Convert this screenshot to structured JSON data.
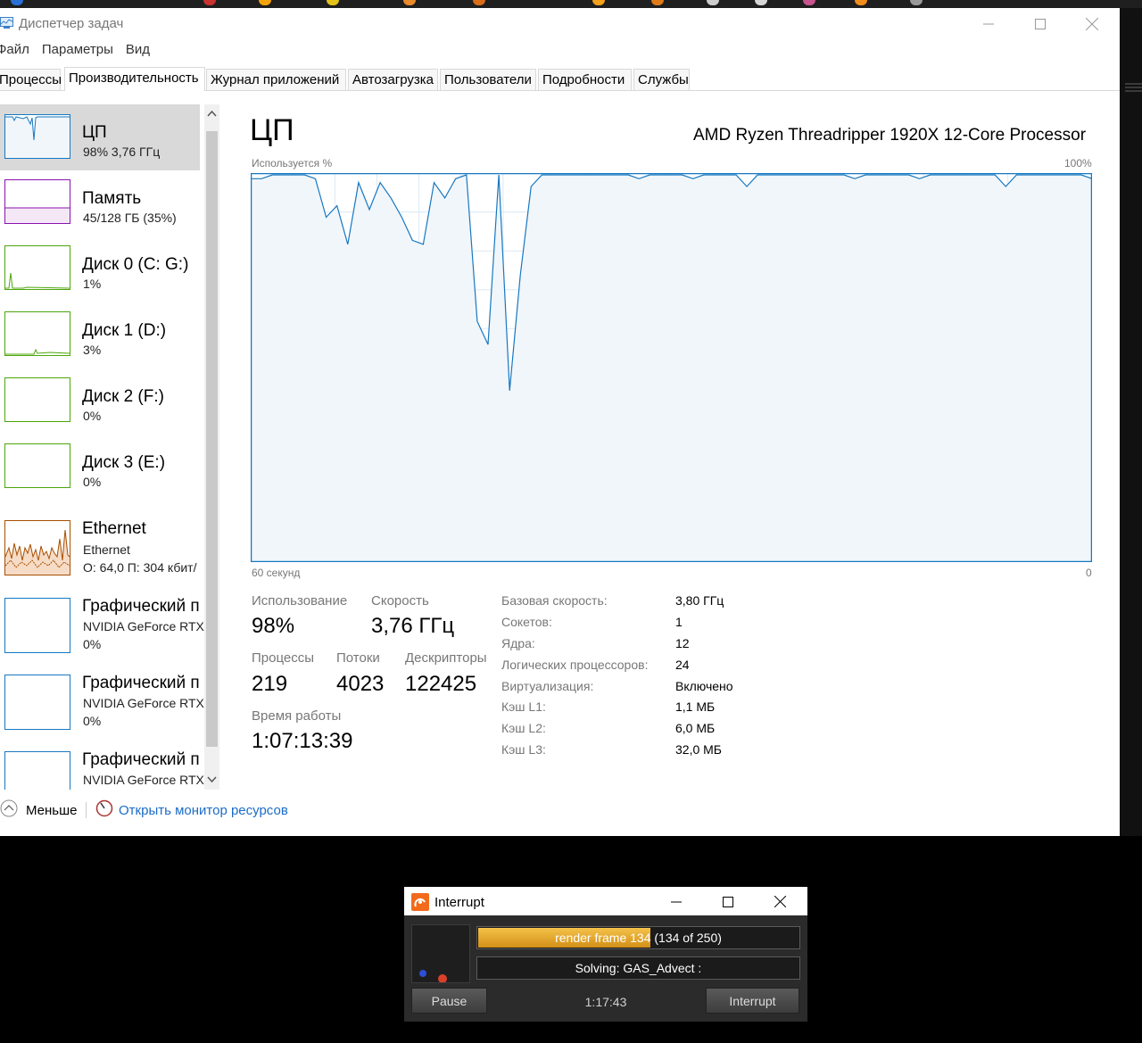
{
  "window": {
    "title": "Диспетчер задач",
    "menu": [
      "Файл",
      "Параметры",
      "Вид"
    ],
    "tabs": [
      "Процессы",
      "Производительность",
      "Журнал приложений",
      "Автозагрузка",
      "Пользователи",
      "Подробности",
      "Службы"
    ],
    "active_tab": "Производительность"
  },
  "sidebar": {
    "items": [
      {
        "name": "ЦП",
        "sub": "98%  3,76 ГГц",
        "color": "#1778c1",
        "selected": true
      },
      {
        "name": "Память",
        "sub": "45/128 ГБ (35%)",
        "color": "#8b12ae"
      },
      {
        "name": "Диск 0 (C: G:)",
        "sub": "1%",
        "color": "#4da60c"
      },
      {
        "name": "Диск 1 (D:)",
        "sub": "3%",
        "color": "#4da60c"
      },
      {
        "name": "Диск 2 (F:)",
        "sub": "0%",
        "color": "#4da60c"
      },
      {
        "name": "Диск 3 (E:)",
        "sub": "0%",
        "color": "#4da60c"
      },
      {
        "name": "Ethernet",
        "sub": "Ethernet",
        "sub2": "О: 64,0  П: 304 кбит/",
        "color": "#a74f01"
      },
      {
        "name": "Графический п",
        "sub": "NVIDIA GeForce RTX",
        "sub2": "0%",
        "color": "#1778c1"
      },
      {
        "name": "Графический п",
        "sub": "NVIDIA GeForce RTX",
        "sub2": "0%",
        "color": "#1778c1"
      },
      {
        "name": "Графический п",
        "sub": "NVIDIA GeForce RTX",
        "color": "#1778c1"
      }
    ]
  },
  "cpu": {
    "title": "ЦП",
    "model": "AMD Ryzen Threadripper 1920X 12-Core Processor",
    "graph": {
      "top_left": "Используется %",
      "top_right": "100%",
      "bottom_left": "60 секунд",
      "bottom_right": "0",
      "line_color": "#1778c1",
      "fill_color": "#f1f6fa",
      "grid_color": "#d9eaf4",
      "usage_percent": [
        99,
        99,
        100,
        100,
        100,
        100,
        99,
        89,
        92,
        82,
        98,
        91,
        98,
        94,
        89,
        83,
        82,
        98,
        94,
        99,
        100,
        62,
        56,
        100,
        44,
        74,
        97,
        100,
        100,
        100,
        100,
        100,
        100,
        100,
        100,
        100,
        99,
        100,
        100,
        100,
        100,
        99,
        100,
        100,
        100,
        100,
        97,
        100,
        100,
        100,
        100,
        100,
        100,
        100,
        100,
        100,
        99,
        100,
        100,
        100,
        100,
        100,
        99,
        100,
        100,
        100,
        100,
        100,
        100,
        100,
        97,
        100,
        100,
        100,
        100,
        100,
        100,
        100,
        99
      ]
    },
    "stats": {
      "usage_label": "Использование",
      "usage": "98%",
      "speed_label": "Скорость",
      "speed": "3,76 ГГц",
      "processes_label": "Процессы",
      "processes": "219",
      "threads_label": "Потоки",
      "threads": "4023",
      "handles_label": "Дескрипторы",
      "handles": "122425",
      "uptime_label": "Время работы",
      "uptime": "1:07:13:39"
    },
    "info": [
      {
        "label": "Базовая скорость:",
        "value": "3,80 ГГц"
      },
      {
        "label": "Сокетов:",
        "value": "1"
      },
      {
        "label": "Ядра:",
        "value": "12"
      },
      {
        "label": "Логических процессоров:",
        "value": "24"
      },
      {
        "label": "Виртуализация:",
        "value": "Включено"
      },
      {
        "label": "Кэш L1:",
        "value": "1,1 МБ"
      },
      {
        "label": "Кэш L2:",
        "value": "6,0 МБ"
      },
      {
        "label": "Кэш L3:",
        "value": "32,0 МБ"
      }
    ]
  },
  "footer": {
    "less": "Меньше",
    "monitor_link": "Открыть монитор ресурсов"
  },
  "interrupt": {
    "title": "Interrupt",
    "progress_text": "render frame 134 (134 of 250)",
    "progress_fraction": 0.536,
    "status_text": "Solving: GAS_Advect :",
    "pause": "Pause",
    "elapsed": "1:17:43",
    "interrupt": "Interrupt"
  }
}
